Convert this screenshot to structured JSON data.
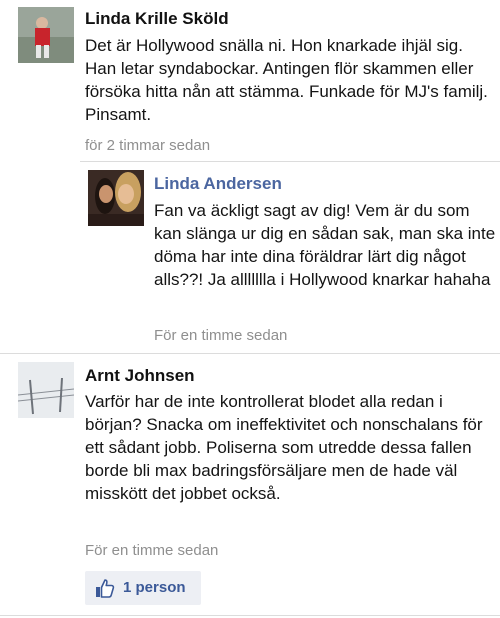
{
  "comments": [
    {
      "author": "Linda Krille Sköld",
      "text": "Det är Hollywood snälla ni. Hon knarkade ihjäl sig. Han letar syndabockar. Antingen flör skammen eller försöka hitta nån att stämma. Funkade för MJ's familj. Pinsamt.",
      "time": "för 2 timmar sedan"
    },
    {
      "author": "Linda Andersen",
      "text": "Fan va äckligt sagt av dig! Vem är du som kan slänga ur dig en sådan sak, man ska inte döma har inte dina föräldrar lärt dig något alls??! Ja allllllla i Hollywood knarkar hahaha",
      "time": "För en timme sedan"
    },
    {
      "author": "Arnt Johnsen",
      "text": "Varför har de inte kontrollerat blodet alla redan i början? Snacka om ineffektivitet och nonschalans för ett sådant jobb. Poliserna som utredde dessa fallen borde bli max badringsförsäljare men de hade väl misskött det jobbet också.",
      "time": "För en timme sedan",
      "likes": "1 person"
    }
  ],
  "colors": {
    "reply_name": "#4b66a0",
    "like_text": "#3b5998",
    "like_bg": "#edeff4",
    "timestamp": "#8f8f8f"
  },
  "icons": {
    "like": "thumbs-up-icon"
  }
}
